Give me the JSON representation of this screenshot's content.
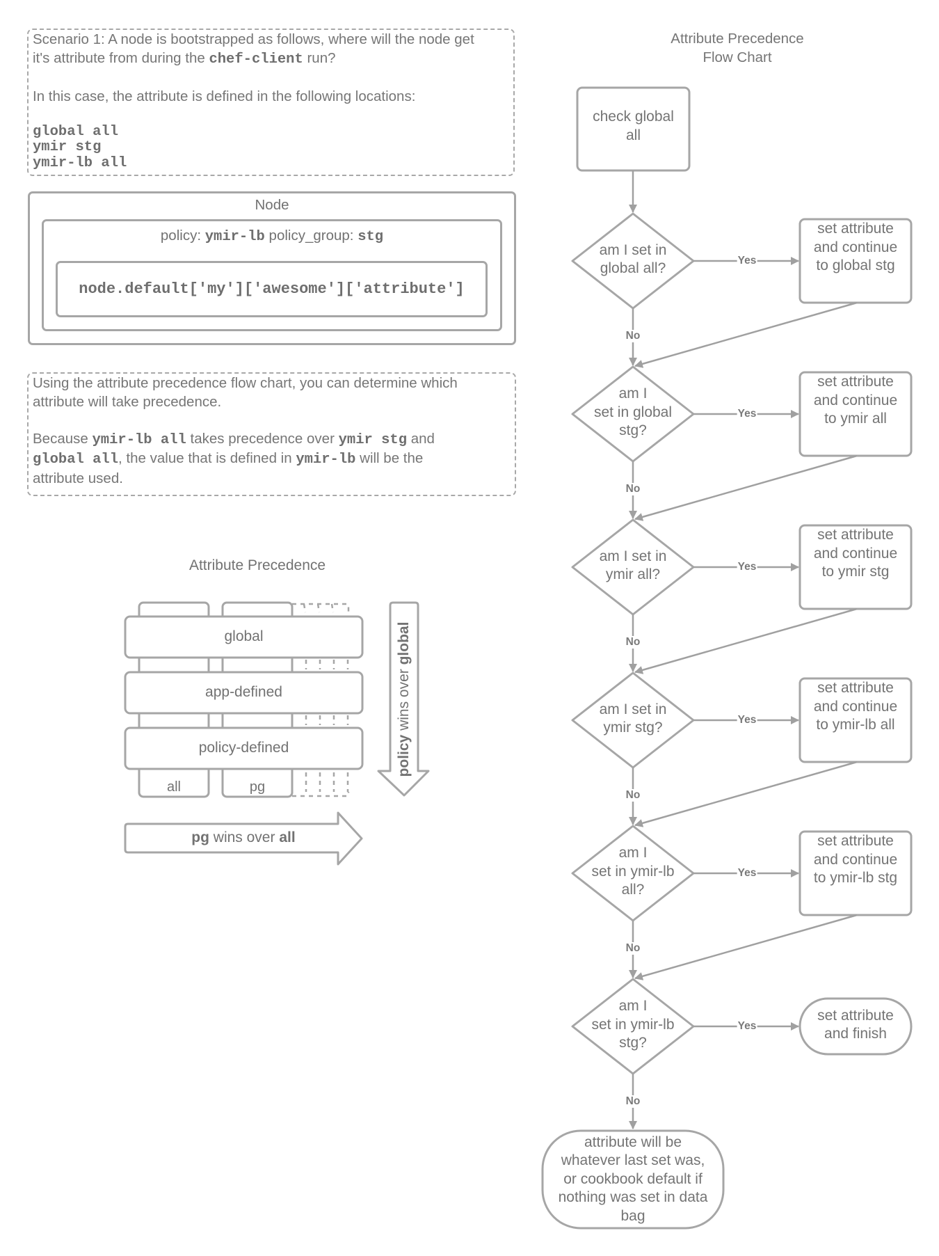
{
  "scenario": {
    "line1": "Scenario 1: A node is bootstrapped as follows, where will the node get",
    "line2_prefix": "it's attribute from during the ",
    "line2_code": "chef-client",
    "line2_suffix": " run?",
    "intro": "In this case, the attribute is defined in the following locations:",
    "locations": [
      "global all",
      "ymir stg",
      "ymir-lb all"
    ]
  },
  "node": {
    "title": "Node",
    "policy_label": "policy: ",
    "policy_value": "ymir-lb",
    "group_label": " policy_group: ",
    "group_value": "stg",
    "code": "node.default['my']['awesome']['attribute']"
  },
  "explanation": {
    "line1": "Using the attribute precedence flow chart, you can determine which",
    "line2": "attribute will take precedence.",
    "p2_a": "Because ",
    "p2_b": "ymir-lb all",
    "p2_c": " takes precedence over ",
    "p2_d": "ymir stg",
    "p2_e": " and",
    "p2_f": "global all",
    "p2_g": ", the value that is defined in ",
    "p2_h": "ymir-lb",
    "p2_i": " will be the",
    "p2_j": "attribute used."
  },
  "precedence": {
    "title": "Attribute Precedence",
    "layers": [
      "global",
      "app-defined",
      "policy-defined"
    ],
    "columns": [
      "all",
      "pg"
    ],
    "vertical_arrow": {
      "bold_a": "policy",
      "text": " wins over ",
      "bold_b": "global"
    },
    "horizontal_arrow": {
      "bold_a": "pg",
      "text": " wins over ",
      "bold_b": "all"
    }
  },
  "flowchart": {
    "title_line1": "Attribute Precedence",
    "title_line2": "Flow Chart",
    "start": [
      "check global",
      "all"
    ],
    "yes_label": "Yes",
    "no_label": "No",
    "decisions": [
      {
        "q": [
          "am I set in",
          "global all?"
        ],
        "action": [
          "set attribute",
          "and continue",
          "to global stg"
        ]
      },
      {
        "q": [
          "am I",
          "set in global",
          "stg?"
        ],
        "action": [
          "set attribute",
          "and continue",
          "to ymir all"
        ]
      },
      {
        "q": [
          "am I set in",
          "ymir all?"
        ],
        "action": [
          "set attribute",
          "and continue",
          "to ymir stg"
        ]
      },
      {
        "q": [
          "am I set in",
          "ymir stg?"
        ],
        "action": [
          "set attribute",
          "and continue",
          "to ymir-lb all"
        ]
      },
      {
        "q": [
          "am I",
          "set in ymir-lb",
          "all?"
        ],
        "action": [
          "set attribute",
          "and continue",
          "to ymir-lb stg"
        ]
      },
      {
        "q": [
          "am I",
          "set in ymir-lb",
          "stg?"
        ],
        "action": [
          "set attribute",
          "and finish"
        ]
      }
    ],
    "end": [
      "attribute will be",
      "whatever last set was,",
      "or cookbook default if",
      "nothing was set in data",
      "bag"
    ]
  },
  "colors": {
    "stroke": "#a6a6a6",
    "text": "#727272",
    "background": "#ffffff"
  }
}
